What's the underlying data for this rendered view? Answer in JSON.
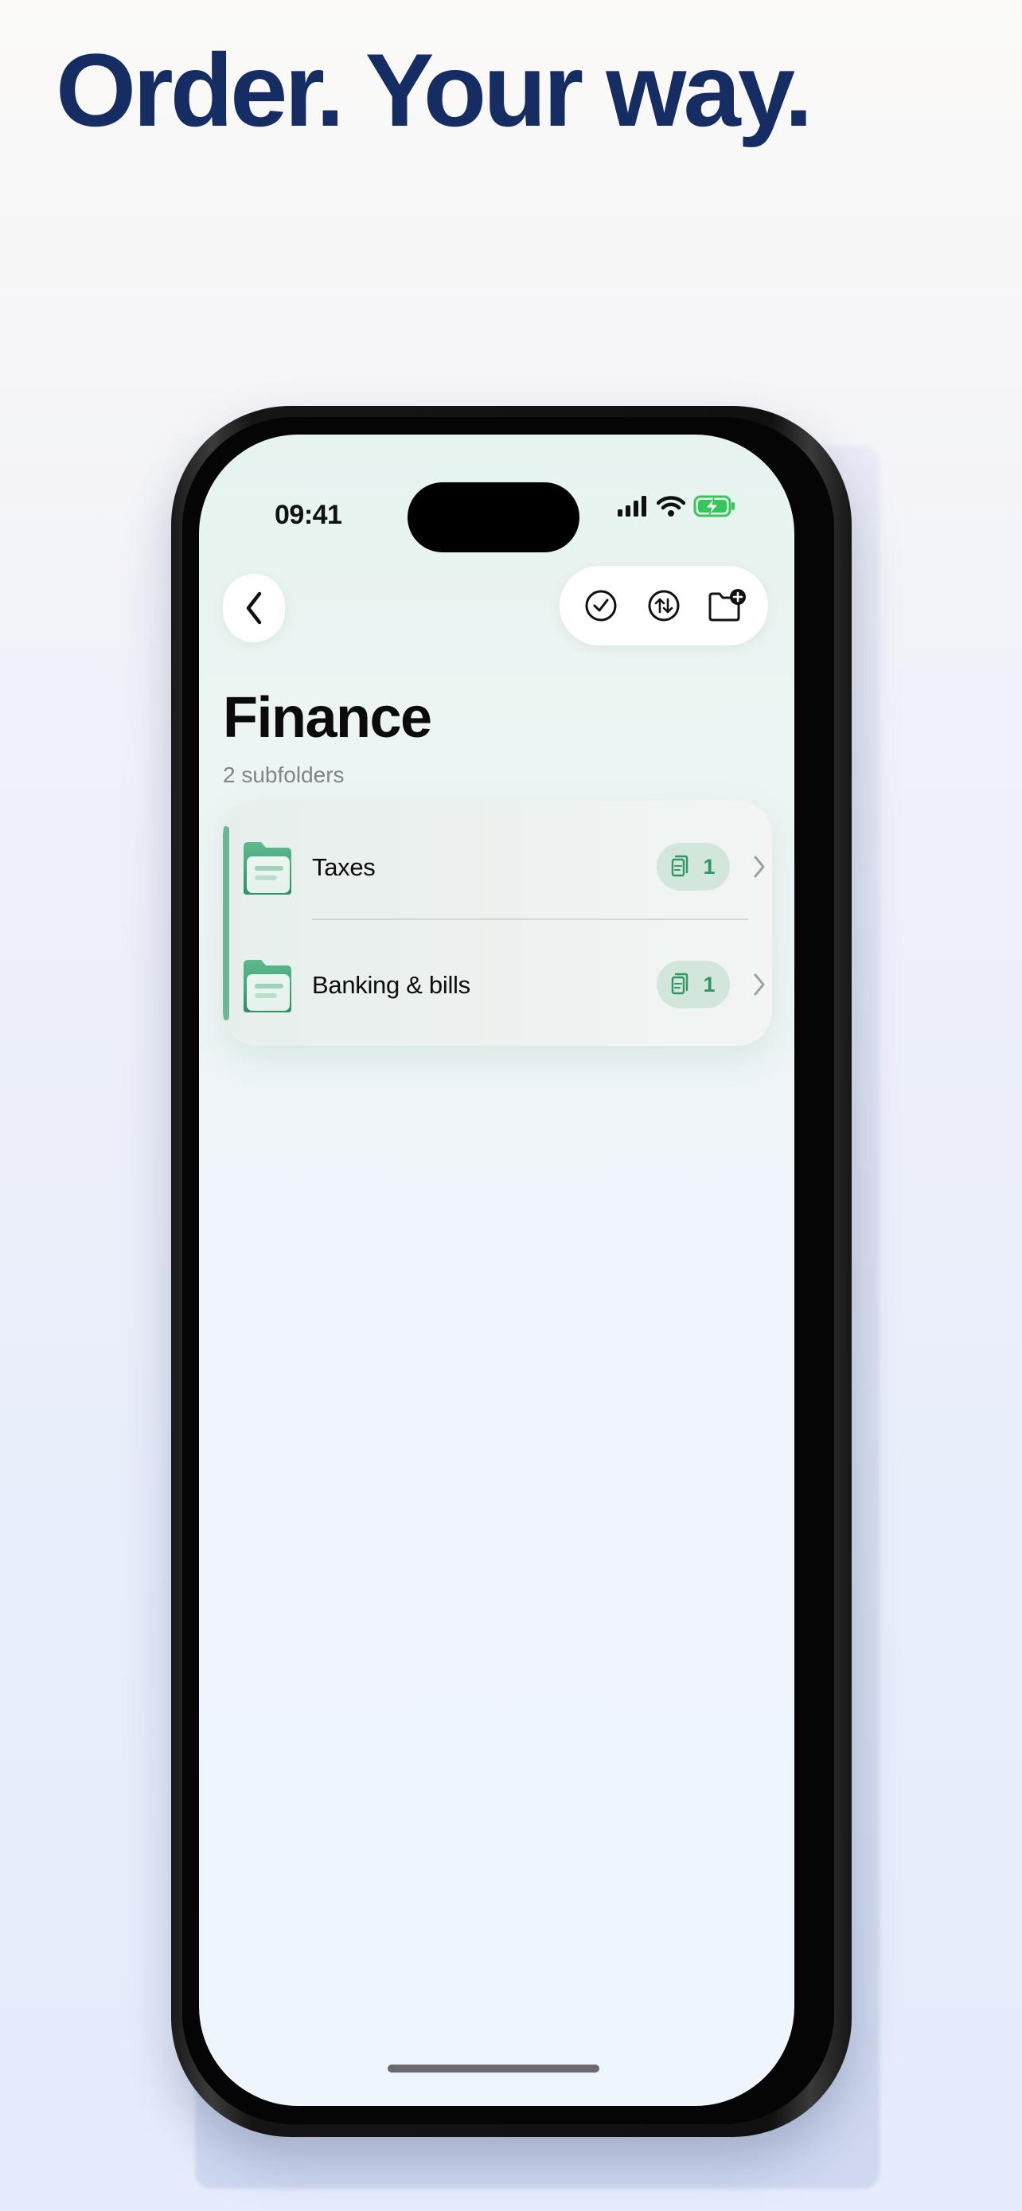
{
  "headline": "Order. Your way.",
  "status_bar": {
    "time": "09:41"
  },
  "header": {
    "title": "Finance",
    "subtitle": "2 subfolders"
  },
  "folders": [
    {
      "label": "Taxes",
      "count": "1"
    },
    {
      "label": "Banking & bills",
      "count": "1"
    }
  ],
  "icons": {
    "back": "chevron-left-icon",
    "select": "checkmark-circle-icon",
    "sort": "sort-arrows-icon",
    "new_folder": "folder-plus-icon",
    "document": "documents-icon",
    "row_arrow": "chevron-right-icon"
  },
  "colors": {
    "headline": "#152d63",
    "accent_green": "#2f9865",
    "badge_bg": "#d2e6dc",
    "battery": "#34c759"
  }
}
